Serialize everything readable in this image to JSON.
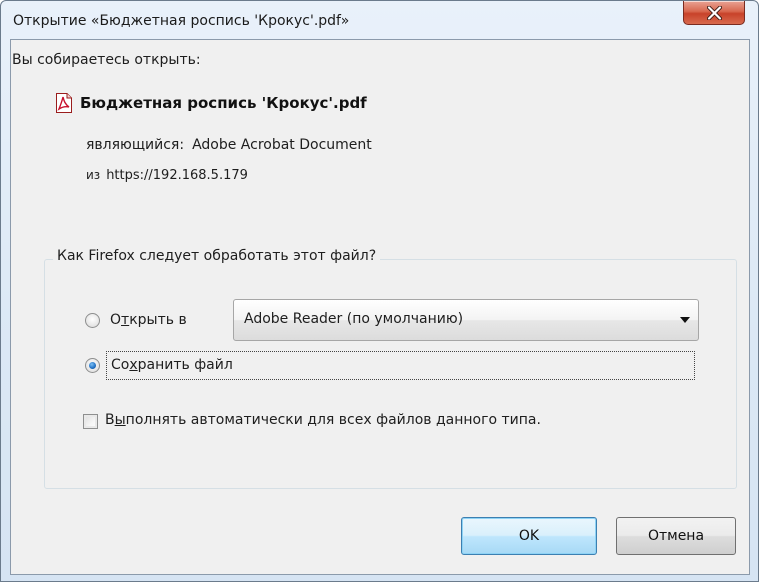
{
  "window": {
    "title": "Открытие «Бюджетная роспись 'Крокус'.pdf»"
  },
  "dialog": {
    "prompt": "Вы собираетесь открыть:",
    "file_name": "Бюджетная роспись 'Крокус'.pdf",
    "file_icon": "pdf-file-icon",
    "type_label": "являющийся:",
    "type_value": "Adobe Acrobat Document",
    "from_label": "из",
    "from_value": "https://192.168.5.179"
  },
  "handling": {
    "question": "Как Firefox следует обработать этот файл?",
    "open_with": {
      "label_pre": "О",
      "label_accel": "т",
      "label_post": "крыть в",
      "selected": false
    },
    "app_select": {
      "value": "Adobe Reader  (по умолчанию)"
    },
    "save_file": {
      "label_pre": "Со",
      "label_accel": "х",
      "label_post": "ранить файл",
      "selected": true
    },
    "auto": {
      "label_pre": "В",
      "label_accel": "ы",
      "label_post": "полнять автоматически для всех файлов данного типа.",
      "checked": false
    }
  },
  "buttons": {
    "ok": "OK",
    "cancel": "Отмена"
  },
  "colors": {
    "close_button": "#c8422a",
    "default_button_border": "#3c7fb1",
    "radio_selected": "#1f6fc4",
    "pdf_icon": "#c8102e"
  }
}
